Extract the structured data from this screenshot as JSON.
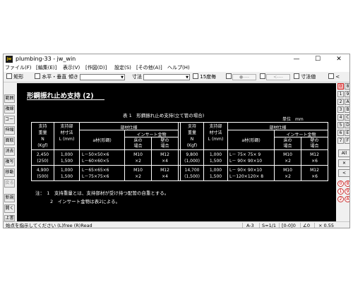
{
  "window": {
    "app_badge": "jw",
    "title": "plumbing-33 - jw_win",
    "minimize_glyph": "—",
    "maximize_glyph": "☐",
    "close_glyph": "✕"
  },
  "menu": [
    "ファイル(F)",
    "[編集(E)]",
    "表示(V)",
    "[作図(D)]",
    "設定(S)",
    "[その他(A)]",
    "ヘルプ(H)"
  ],
  "toolbar": {
    "rect_label": "矩形",
    "hv_label": "水平・垂直",
    "angle_label": "傾き",
    "dim_label": "寸法",
    "deg15_label": "15度毎",
    "btn_a": "●----",
    "btn_b": "<----",
    "dimvalue_label": "寸法値",
    "lt_label": "<"
  },
  "left_tools": [
    "範囲",
    "複線",
    "コーナー",
    "伸縮",
    "面取",
    "消去",
    "複写",
    "移動",
    "戻る",
    "新規",
    "開く",
    "上書"
  ],
  "right_tools": {
    "layer_rows": [
      [
        "0",
        "8"
      ],
      [
        "1",
        "9"
      ],
      [
        "2",
        "A"
      ],
      [
        "3",
        "B"
      ],
      [
        "4",
        "C"
      ],
      [
        "5",
        "D"
      ],
      [
        "6",
        "E"
      ],
      [
        "7",
        "F"
      ]
    ],
    "all_label": "All",
    "x_label": "✕",
    "minus_label": "<",
    "group_rows": [
      [
        "0",
        "8"
      ],
      [
        "1",
        "9"
      ],
      [
        "2",
        "A"
      ]
    ]
  },
  "drawing": {
    "heading": "形鋼振れ止め支持 (2)",
    "table_title": "表 1　形鋼振れ止め支持(立て管の場合)",
    "unit": "単位　mm",
    "headers": {
      "load": [
        "支持",
        "重量",
        "N",
        "(Kgf)"
      ],
      "dim": [
        "支持部",
        "材寸法",
        "L (mm)"
      ],
      "spec": "部材仕様",
      "amaterial": "a材(形鋼)",
      "insert": "インサート金物",
      "floor": [
        "床の",
        "場合"
      ],
      "wall": [
        "壁の",
        "場合"
      ]
    },
    "left_rows": [
      {
        "load": [
          "2,450",
          "(250)"
        ],
        "dim": [
          "1,000",
          "1,500"
        ],
        "a": [
          "L－50×50×6",
          "L－60×60×5"
        ],
        "floor": [
          "M10",
          "×2"
        ],
        "wall": [
          "M12",
          "×4"
        ]
      },
      {
        "load": [
          "4,900",
          "(500)"
        ],
        "dim": [
          "1,000",
          "1,500"
        ],
        "a": [
          "L－65×65×6",
          "L－75×75×6"
        ],
        "floor": [
          "M10",
          "×2"
        ],
        "wall": [
          "M12",
          "×4"
        ]
      }
    ],
    "right_rows": [
      {
        "load": [
          "9,800",
          "(1,000)"
        ],
        "dim": [
          "1,000",
          "1,500"
        ],
        "a": [
          "L－ 75× 75× 9",
          "L－ 90× 90×10"
        ],
        "floor": [
          "M10",
          "×2"
        ],
        "wall": [
          "M12",
          "×6"
        ]
      },
      {
        "load": [
          "14,700",
          "(1,500)"
        ],
        "dim": [
          "1,000",
          "1,500"
        ],
        "a": [
          "L－ 90× 90×10",
          "L－120×120× 8"
        ],
        "floor": [
          "M10",
          "×2"
        ],
        "wall": [
          "M12",
          "×6"
        ]
      }
    ],
    "notes": [
      "注：　1　支持重量とは、支持部材が受け持つ配管の自重とする。",
      "2　インサート金物は表2による。"
    ]
  },
  "status": {
    "message": "始点を指示してください (L)free (R)Read",
    "paper": "A-3",
    "scale": "S=1/1",
    "layer": "[0-0]0",
    "angle": "∠0",
    "zoom": "× 0.55"
  }
}
